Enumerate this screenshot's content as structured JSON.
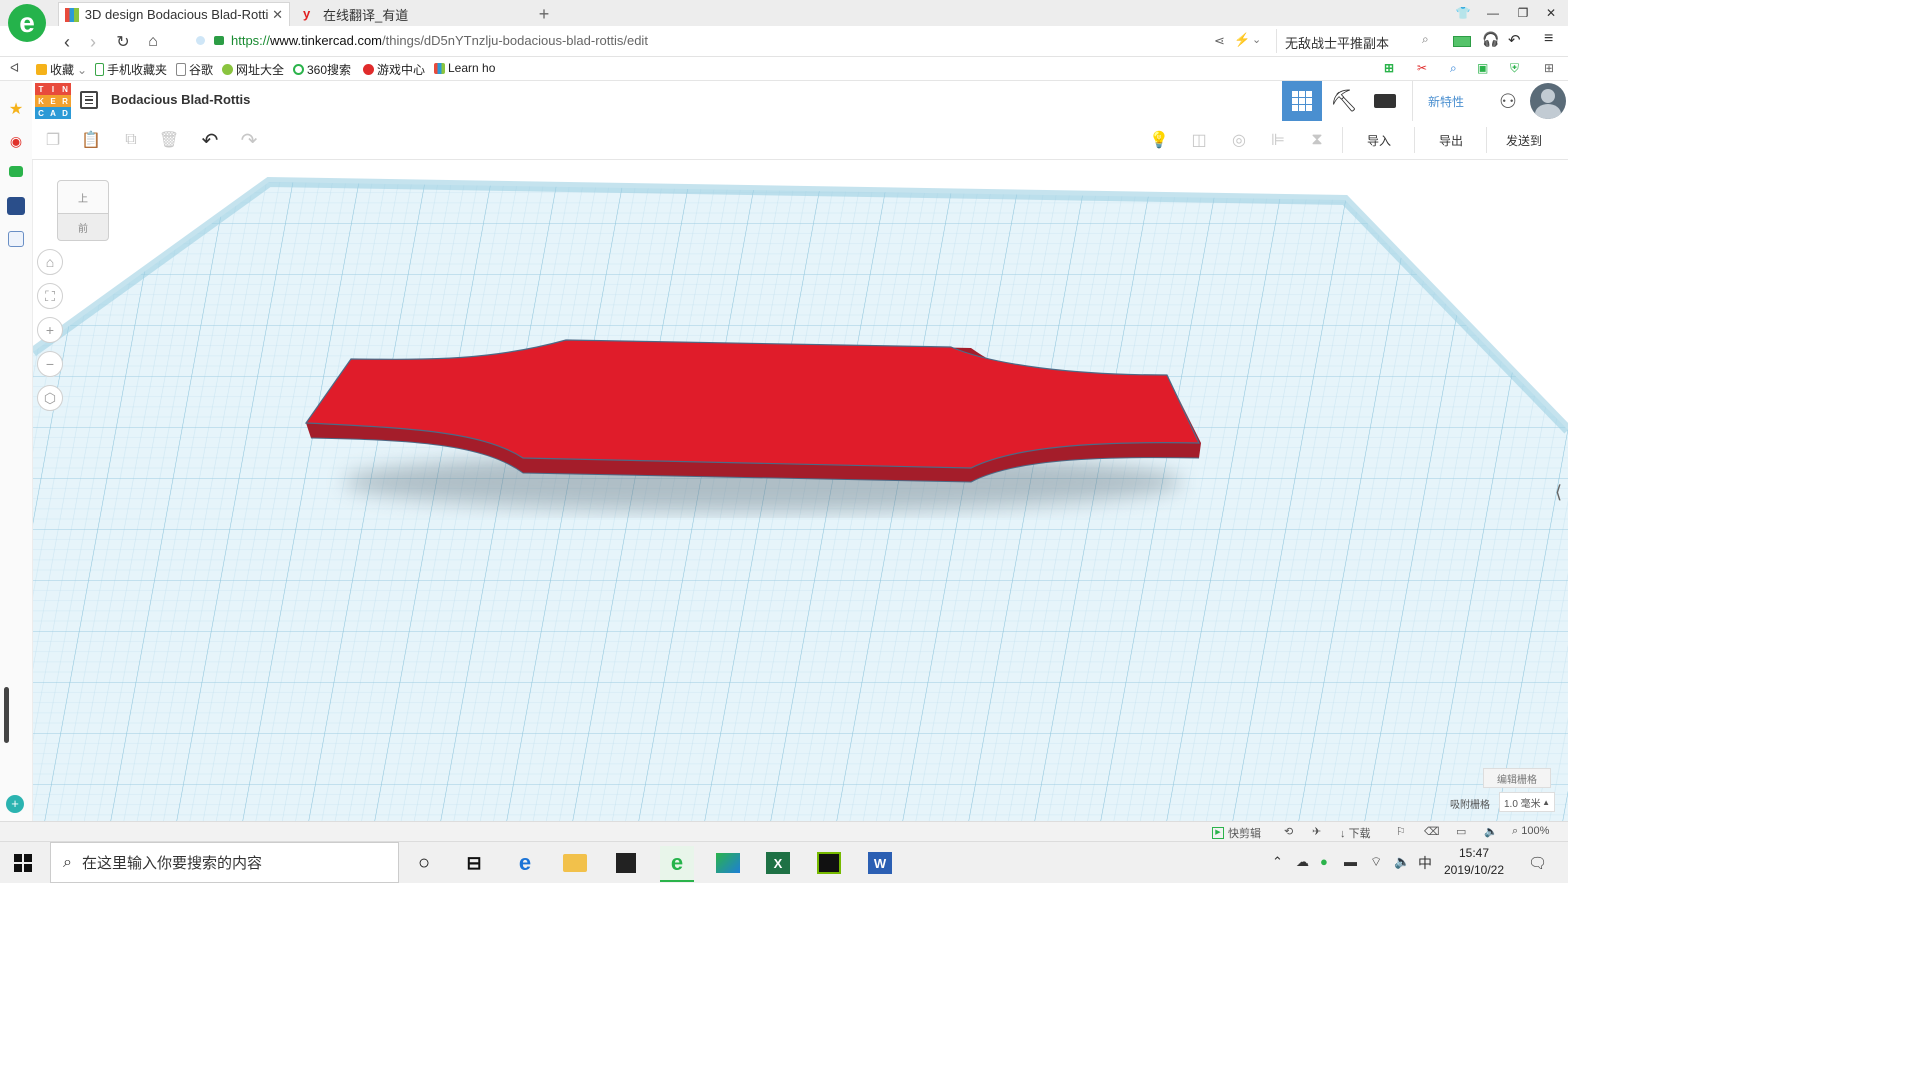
{
  "browser": {
    "tabs": [
      {
        "label": "3D design Bodacious Blad-Rotti",
        "active": true
      },
      {
        "label": "在线翻译_有道",
        "active": false
      }
    ],
    "new_tab_label": "+",
    "url_scheme": "https://",
    "url_host": "www.tinkercad.com",
    "url_path": "/things/dD5nYTnzlju-bodacious-blad-rottis/edit",
    "search_box_text": "无敌战士平推副本",
    "bookmarks": [
      "收藏",
      "手机收藏夹",
      "谷歌",
      "网址大全",
      "360搜索",
      "游戏中心",
      "Learn ho"
    ]
  },
  "app": {
    "logo_letters": [
      "T",
      "I",
      "N",
      "K",
      "E",
      "R",
      "C",
      "A",
      "D"
    ],
    "design_name": "Bodacious Blad-Rottis",
    "new_features": "新特性",
    "import_label": "导入",
    "export_label": "导出",
    "send_label": "发送到"
  },
  "viewcube": {
    "top": "上",
    "front": "前"
  },
  "grid": {
    "edit_grid": "编辑栅格",
    "snap_grid": "吸附栅格",
    "snap_value": "1.0 毫米"
  },
  "shape": {
    "color": "#e01c2a",
    "side_color": "#b0202b",
    "edge_color": "#4d6a86"
  },
  "statusbar": {
    "kuaijianji": "快剪辑",
    "download": "下载",
    "zoom": "100%"
  },
  "taskbar": {
    "search_placeholder": "在这里输入你要搜索的内容",
    "ime": "中",
    "time": "15:47",
    "date": "2019/10/22"
  },
  "colors": {
    "workplane": "#d9eef7",
    "grid_line": "#9ccbe0",
    "accent": "#4a8fd0"
  }
}
